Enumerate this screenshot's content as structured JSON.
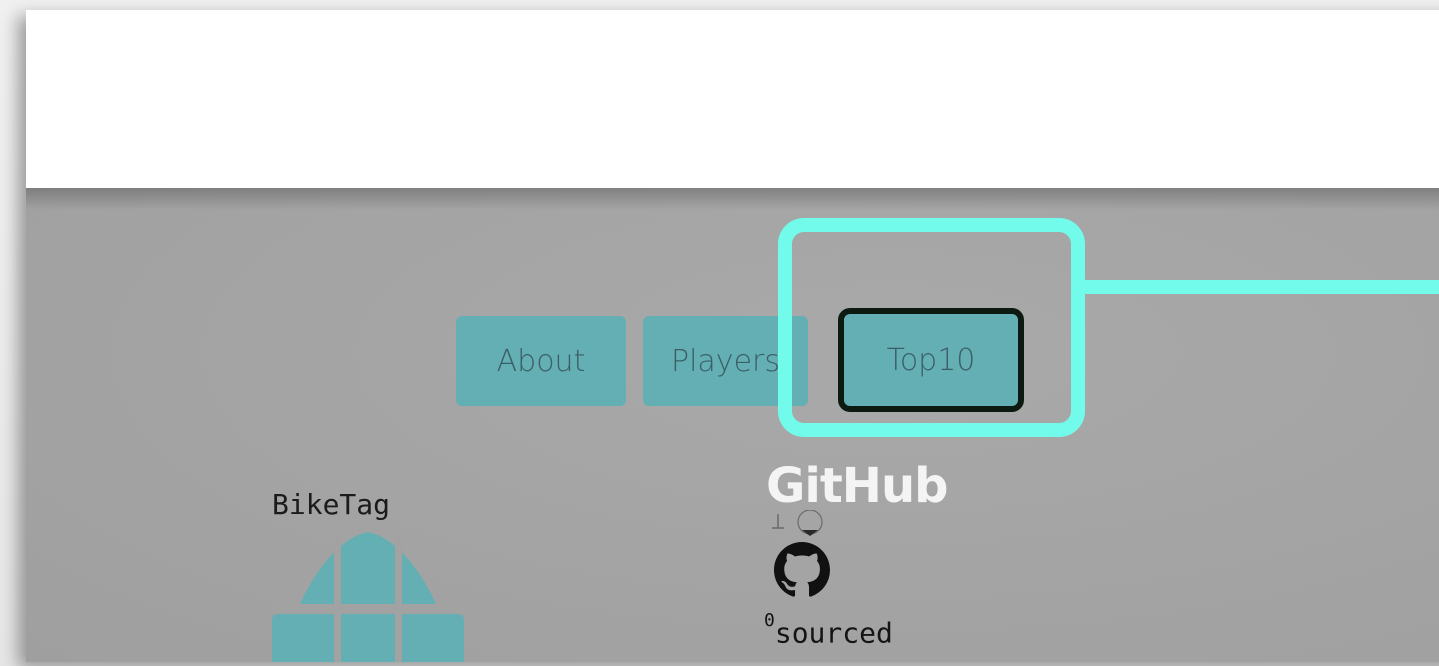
{
  "nav": {
    "about_label": "About",
    "players_label": "Players",
    "top10_label": "Top10"
  },
  "footer": {
    "brand_title": "BikeTag",
    "github_word": "GitHub",
    "sourced_count": "0",
    "sourced_label": "sourced"
  },
  "colors": {
    "button_teal": "#63afb4",
    "highlight": "#72fbea",
    "background_grey": "#a2a2a2"
  },
  "icons": {
    "biketag_logo": "globe-icon",
    "github_logo": "octocat-icon"
  }
}
